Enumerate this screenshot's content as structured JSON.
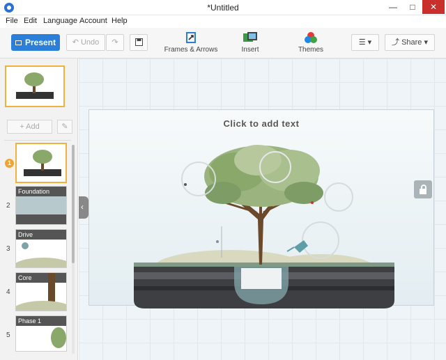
{
  "window": {
    "title": "*Untitled"
  },
  "menu": {
    "items": [
      "File",
      "Edit",
      "Language",
      "Account",
      "Help"
    ]
  },
  "toolbar": {
    "present_label": "Present",
    "undo_label": "Undo",
    "frames_label": "Frames & Arrows",
    "insert_label": "Insert",
    "themes_label": "Themes",
    "share_label": "Share"
  },
  "sidebar": {
    "add_label": "+ Add",
    "slides": [
      {
        "number": "1",
        "label": ""
      },
      {
        "number": "2",
        "label": "Foundation"
      },
      {
        "number": "3",
        "label": "Drive"
      },
      {
        "number": "4",
        "label": "Core"
      },
      {
        "number": "5",
        "label": "Phase 1"
      }
    ]
  },
  "canvas": {
    "placeholder_text": "Click to add text"
  },
  "colors": {
    "accent": "#2b7fd9",
    "selection": "#f0b23a",
    "close": "#c9302c"
  }
}
